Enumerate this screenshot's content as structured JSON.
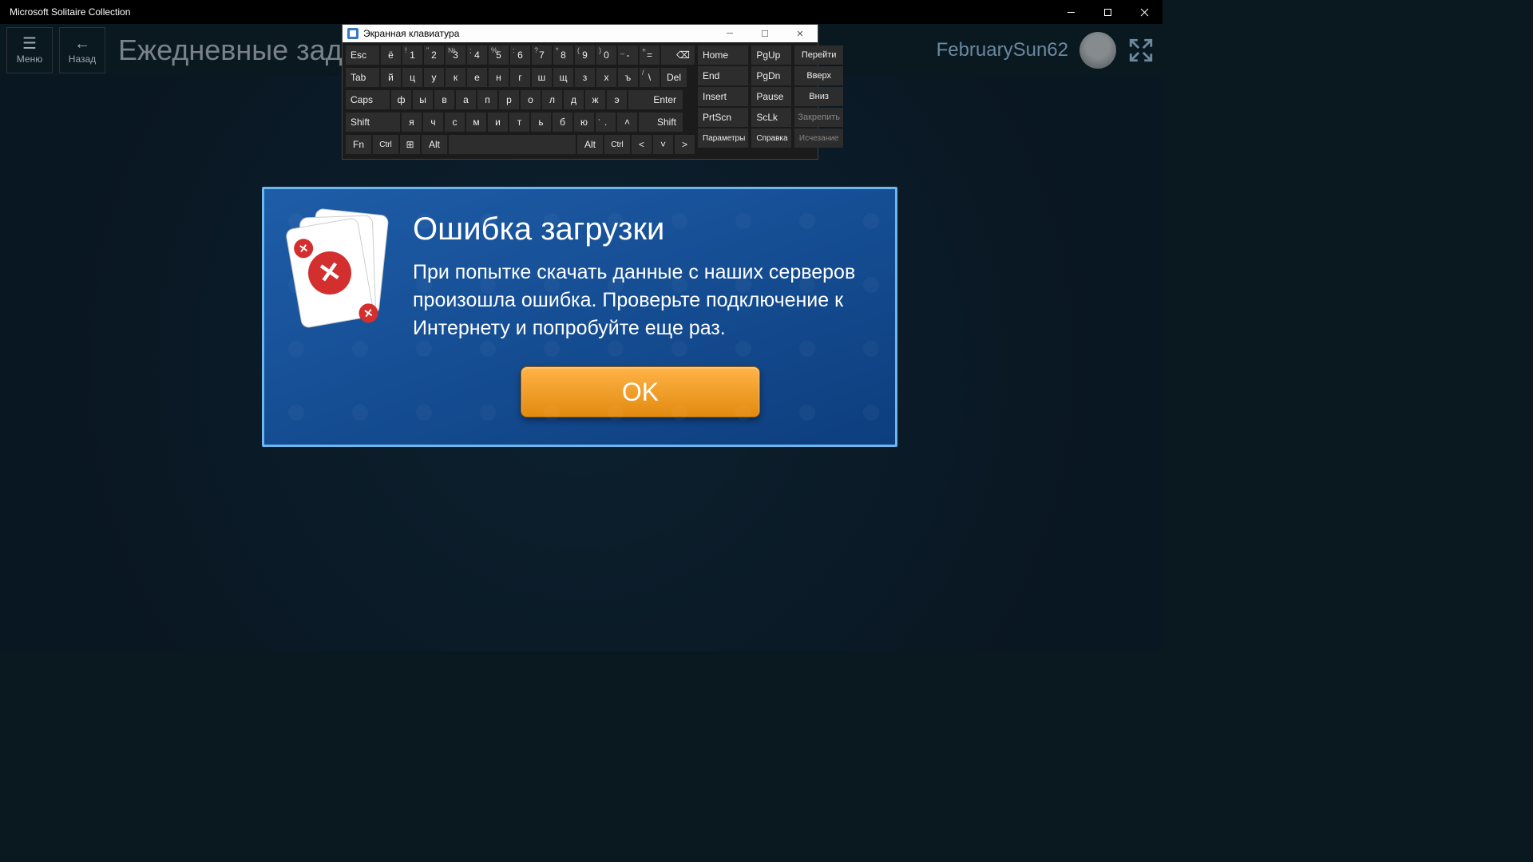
{
  "window": {
    "title": "Microsoft Solitaire Collection"
  },
  "header": {
    "menu_label": "Меню",
    "back_label": "Назад",
    "page_title": "Ежедневные задан",
    "username": "FebruarySun62"
  },
  "osk": {
    "title": "Экранная клавиатура",
    "rows": {
      "r1": [
        "Esc",
        "ё",
        "1",
        "2",
        "3",
        "4",
        "5",
        "6",
        "7",
        "8",
        "9",
        "0",
        "-",
        "="
      ],
      "r1_sup": [
        "",
        "",
        "!",
        "\"",
        "№",
        ";",
        "%",
        ":",
        "?",
        "*",
        "(",
        ")",
        "_",
        "+"
      ],
      "r1_end": "⌫",
      "r2": [
        "Tab",
        "й",
        "ц",
        "у",
        "к",
        "е",
        "н",
        "г",
        "ш",
        "щ",
        "з",
        "х",
        "ъ",
        "\\",
        "Del"
      ],
      "r2_sup_slash": "/",
      "r3": [
        "Caps",
        "ф",
        "ы",
        "в",
        "а",
        "п",
        "р",
        "о",
        "л",
        "д",
        "ж",
        "э",
        "Enter"
      ],
      "r4": [
        "Shift",
        "я",
        "ч",
        "с",
        "м",
        "и",
        "т",
        "ь",
        "б",
        "ю",
        ".",
        "˄",
        "Shift"
      ],
      "r4_sup_dot": ",",
      "r5": [
        "Fn",
        "Ctrl",
        "⊞",
        "Alt",
        "",
        "Alt",
        "Ctrl",
        "˂",
        "˅",
        "˃"
      ]
    },
    "nav": {
      "c1": [
        "Home",
        "End",
        "Insert",
        "PrtScn",
        "Параметры"
      ],
      "c2": [
        "PgUp",
        "PgDn",
        "Pause",
        "ScLk",
        "Справка"
      ],
      "c3": [
        "Перейти",
        "Вверх",
        "Вниз",
        "Закрепить",
        "Исчезание"
      ]
    }
  },
  "dialog": {
    "title": "Ошибка загрузки",
    "message": "При попытке скачать данные с наших серверов произошла ошибка. Проверьте подключение к Интернету и попробуйте еще раз.",
    "ok": "OK"
  }
}
